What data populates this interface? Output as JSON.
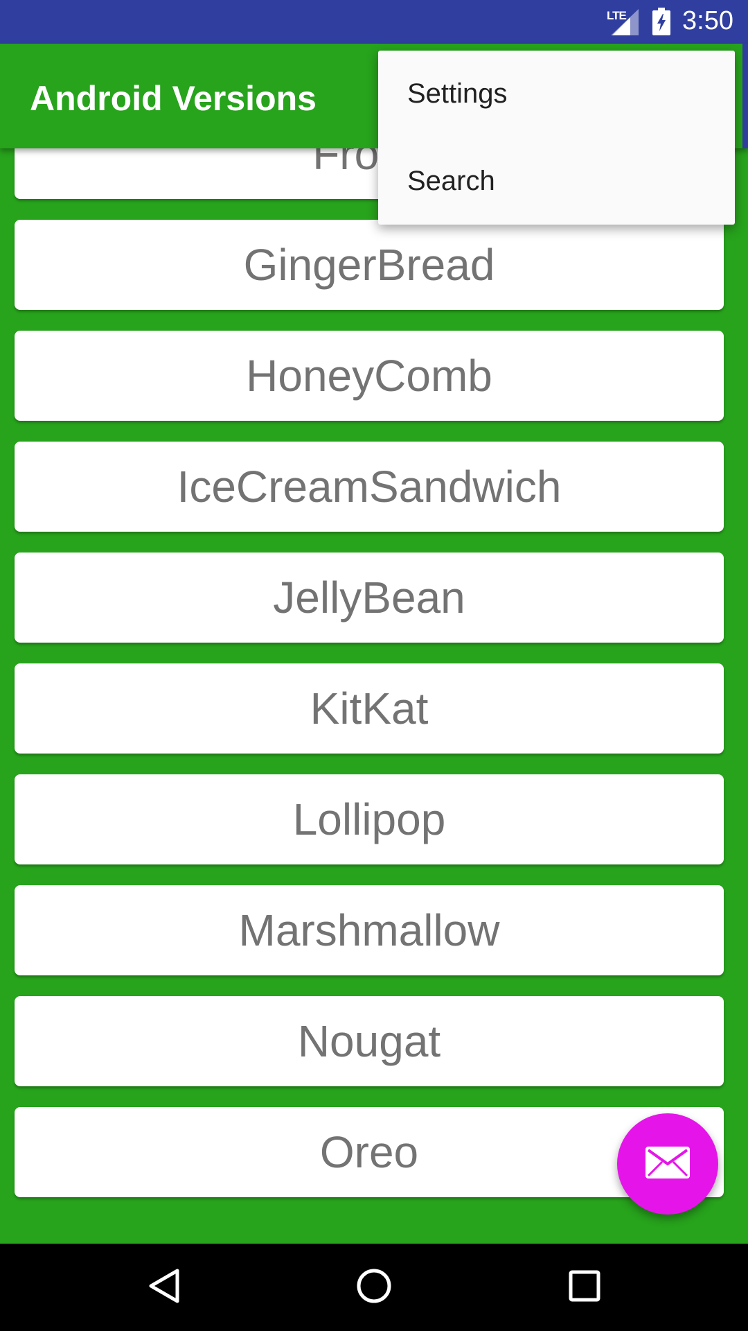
{
  "status_bar": {
    "network_label": "LTE",
    "time": "3:50",
    "icons": [
      "signal-icon",
      "battery-charging-icon"
    ]
  },
  "app_bar": {
    "title": "Android Versions"
  },
  "overflow_menu": {
    "items": [
      {
        "label": "Settings"
      },
      {
        "label": "Search"
      }
    ]
  },
  "versions": [
    {
      "label": "Froyo"
    },
    {
      "label": "GingerBread"
    },
    {
      "label": "HoneyComb"
    },
    {
      "label": "IceCreamSandwich"
    },
    {
      "label": "JellyBean"
    },
    {
      "label": "KitKat"
    },
    {
      "label": "Lollipop"
    },
    {
      "label": "Marshmallow"
    },
    {
      "label": "Nougat"
    },
    {
      "label": "Oreo"
    }
  ],
  "fab": {
    "icon": "email-icon"
  },
  "nav_bar": {
    "icons": [
      "back-icon",
      "home-icon",
      "recents-icon"
    ]
  },
  "colors": {
    "status_bar": "#303F9F",
    "app_bar": "#27A31C",
    "fab": "#E515E9",
    "card_text": "#737373"
  }
}
